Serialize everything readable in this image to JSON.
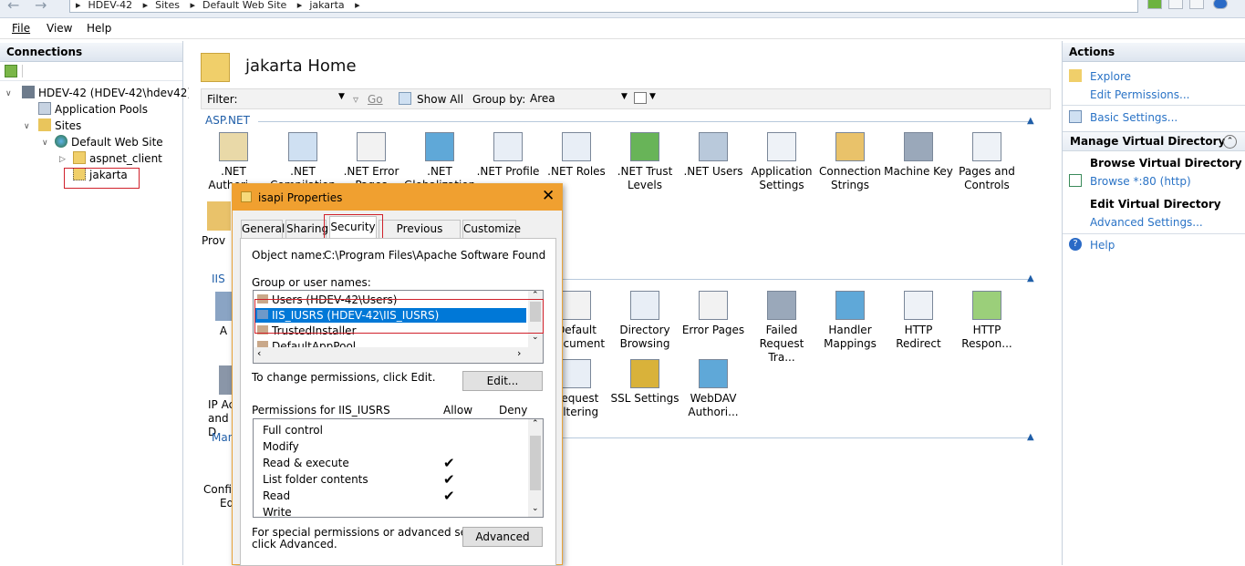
{
  "address": {
    "crumbs": [
      "HDEV-42",
      "Sites",
      "Default Web Site",
      "jakarta"
    ]
  },
  "menu": {
    "file": "File",
    "view": "View",
    "help": "Help"
  },
  "connections": {
    "title": "Connections",
    "tree": {
      "server": "HDEV-42 (HDEV-42\\hdev42)",
      "app_pools": "Application Pools",
      "sites": "Sites",
      "default_site": "Default Web Site",
      "aspnet_client": "aspnet_client",
      "jakarta": "jakarta"
    }
  },
  "main": {
    "title": "jakarta Home",
    "filter": {
      "label": "Filter:",
      "go": "Go",
      "show_all": "Show All",
      "group_by": "Group by:",
      "group_value": "Area"
    },
    "sections": {
      "aspnet": "ASP.NET",
      "iis": "IIS",
      "management": "Man"
    },
    "aspnet_icons": [
      {
        "l1": ".NET",
        "l2": "Authori..."
      },
      {
        "l1": ".NET",
        "l2": "Compilation"
      },
      {
        "l1": ".NET Error",
        "l2": "Pages"
      },
      {
        "l1": ".NET",
        "l2": "Globalization"
      },
      {
        "l1": ".NET Profile",
        "l2": ""
      },
      {
        "l1": ".NET Roles",
        "l2": ""
      },
      {
        "l1": ".NET Trust",
        "l2": "Levels"
      },
      {
        "l1": ".NET Users",
        "l2": ""
      },
      {
        "l1": "Application",
        "l2": "Settings"
      },
      {
        "l1": "Connection",
        "l2": "Strings"
      },
      {
        "l1": "Machine Key",
        "l2": ""
      },
      {
        "l1": "Pages and",
        "l2": "Controls"
      }
    ],
    "aspnet_row2": {
      "l1": "Prov"
    },
    "iis_icons": [
      {
        "l1": "Default",
        "l2": "Document"
      },
      {
        "l1": "Directory",
        "l2": "Browsing"
      },
      {
        "l1": "Error Pages",
        "l2": ""
      },
      {
        "l1": "Failed",
        "l2": "Request Tra..."
      },
      {
        "l1": "Handler",
        "l2": "Mappings"
      },
      {
        "l1": "HTTP",
        "l2": "Redirect"
      },
      {
        "l1": "HTTP",
        "l2": "Respon..."
      }
    ],
    "iis_left": {
      "a": "A",
      "ip1": "IP Ac",
      "ip2": "and D"
    },
    "iis_row2": [
      {
        "l1": "Request",
        "l2": "Filtering"
      },
      {
        "l1": "SSL Settings",
        "l2": ""
      },
      {
        "l1": "WebDAV",
        "l2": "Authori..."
      }
    ],
    "mgmt_left": {
      "l1": "Config",
      "l2": "Ed"
    }
  },
  "actions": {
    "title": "Actions",
    "explore": "Explore",
    "edit_permissions": "Edit Permissions...",
    "basic_settings": "Basic Settings...",
    "manage_vdir": "Manage Virtual Directory",
    "browse_vdir": "Browse Virtual Directory",
    "browse_80": "Browse *:80 (http)",
    "edit_vdir": "Edit Virtual Directory",
    "advanced_settings": "Advanced Settings...",
    "help": "Help"
  },
  "dialog": {
    "title": "isapi Properties",
    "tabs": [
      "General",
      "Sharing",
      "Security",
      "Previous Versions",
      "Customize"
    ],
    "object_name_label": "Object name:",
    "object_name_value": "C:\\Program Files\\Apache Software Foundation\\Tom",
    "group_label": "Group or user names:",
    "users": [
      "Users (HDEV-42\\Users)",
      "IIS_IUSRS (HDEV-42\\IIS_IUSRS)",
      "TrustedInstaller",
      "DefaultAppPool"
    ],
    "change_text": "To change permissions, click Edit.",
    "edit_button": "Edit...",
    "perm_label": "Permissions for IIS_IUSRS",
    "allow": "Allow",
    "deny": "Deny",
    "permissions": [
      "Full control",
      "Modify",
      "Read & execute",
      "List folder contents",
      "Read",
      "Write"
    ],
    "allowed": [
      false,
      false,
      true,
      true,
      true,
      false
    ],
    "special_text_1": "For special permissions or advanced settings,",
    "special_text_2": "click Advanced.",
    "advanced_button": "Advanced"
  }
}
